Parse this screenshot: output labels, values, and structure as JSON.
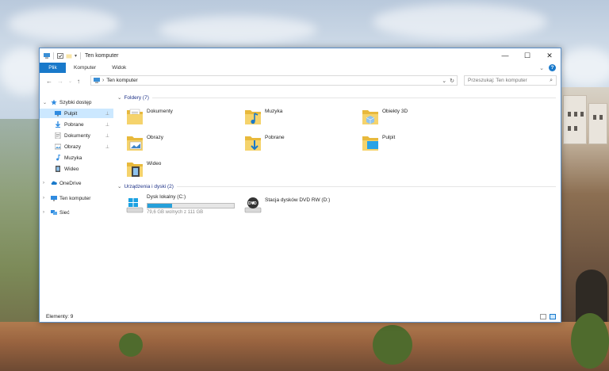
{
  "window": {
    "title": "Ten komputer",
    "controls": {
      "minimize": "—",
      "maximize": "☐",
      "close": "✕"
    }
  },
  "ribbon": {
    "file_tab": "Plik",
    "tabs": [
      "Komputer",
      "Widok"
    ],
    "expand_icon": "chevron-down-icon",
    "help": "?"
  },
  "navbar": {
    "back": "←",
    "forward": "→",
    "recent": "⌄",
    "up": "↑",
    "crumb_separator": "›",
    "address": "Ten komputer",
    "dropdown": "⌄",
    "refresh": "↻",
    "search_placeholder": "Przeszukaj: Ten komputer",
    "search_icon": "⌕"
  },
  "sidebar": {
    "items": [
      {
        "label": "Szybki dostęp",
        "icon": "star-icon",
        "expanded": true
      },
      {
        "label": "Pulpit",
        "icon": "desktop-icon",
        "pinned": true,
        "selected": true
      },
      {
        "label": "Pobrane",
        "icon": "download-icon",
        "pinned": true
      },
      {
        "label": "Dokumenty",
        "icon": "documents-icon",
        "pinned": true
      },
      {
        "label": "Obrazy",
        "icon": "pictures-icon",
        "pinned": true
      },
      {
        "label": "Muzyka",
        "icon": "music-icon"
      },
      {
        "label": "Wideo",
        "icon": "video-icon"
      },
      {
        "label": "OneDrive",
        "icon": "cloud-icon"
      },
      {
        "label": "Ten komputer",
        "icon": "computer-icon"
      },
      {
        "label": "Sieć",
        "icon": "network-icon"
      }
    ],
    "pin_glyph": "📌"
  },
  "content": {
    "folders_header": "Foldery (7)",
    "folders": [
      {
        "label": "Dokumenty",
        "icon": "documents-folder-icon"
      },
      {
        "label": "Muzyka",
        "icon": "music-folder-icon"
      },
      {
        "label": "Obiekty 3D",
        "icon": "3d-objects-folder-icon"
      },
      {
        "label": "Obrazy",
        "icon": "pictures-folder-icon"
      },
      {
        "label": "Pobrane",
        "icon": "downloads-folder-icon"
      },
      {
        "label": "Pulpit",
        "icon": "desktop-folder-icon"
      },
      {
        "label": "Wideo",
        "icon": "video-folder-icon"
      }
    ],
    "devices_header": "Urządzenia i dyski (2)",
    "drives": [
      {
        "label": "Dysk lokalny (C:)",
        "icon": "windows-drive-icon",
        "free_text": "79,6 GB wolnych z 111 GB",
        "used_fraction": 0.28
      },
      {
        "label": "Stacja dysków DVD RW (D:)",
        "icon": "dvd-drive-icon",
        "dvd_badge": "DVD"
      }
    ]
  },
  "status": {
    "items_text": "Elementy: 9"
  },
  "colors": {
    "accent": "#1979ca",
    "selection": "#cce8ff",
    "drive_bar": "#26a0da",
    "folder": "#f2c94c",
    "group_header_text": "#1e3287"
  }
}
